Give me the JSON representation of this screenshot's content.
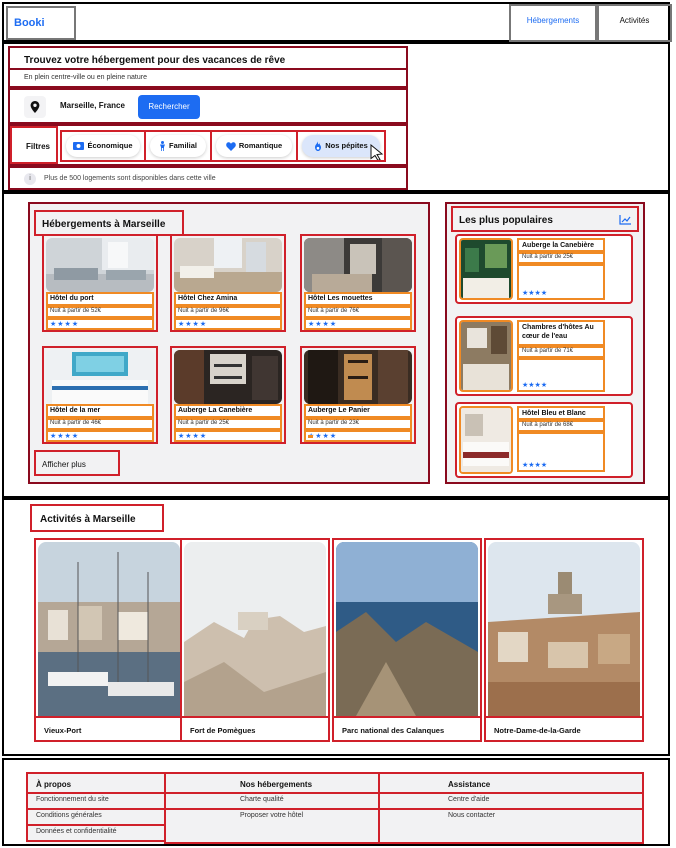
{
  "header": {
    "logo": "Booki",
    "nav": [
      "Hébergements",
      "Activités"
    ]
  },
  "search": {
    "title": "Trouvez votre hébergement pour des vacances de rêve",
    "subtitle": "En plein centre-ville ou en pleine nature",
    "location": "Marseille, France",
    "button": "Rechercher",
    "filters_label": "Filtres",
    "filters": [
      "Économique",
      "Familial",
      "Romantique",
      "Nos pépites"
    ],
    "info_icon": "i",
    "info": "Plus de 500 logements sont disponibles dans cette ville"
  },
  "hotels": {
    "title": "Hébergements à Marseille",
    "items": [
      {
        "name": "Hôtel du port",
        "price": "Nuit à partir de 52€",
        "stars": "★★★★"
      },
      {
        "name": "Hôtel Chez Amina",
        "price": "Nuit à partir de 96€",
        "stars": "★★★★"
      },
      {
        "name": "Hôtel Les mouettes",
        "price": "Nuit à partir de 76€",
        "stars": "★★★★"
      },
      {
        "name": "Hôtel de la mer",
        "price": "Nuit à partir de 46€",
        "stars": "★★★★"
      },
      {
        "name": "Auberge La Canebière",
        "price": "Nuit à partir de 25€",
        "stars": "★★★★"
      },
      {
        "name": "Auberge Le Panier",
        "price": "Nuit à partir de 23€",
        "stars": "★★★★"
      }
    ],
    "more": "Afficher plus"
  },
  "popular": {
    "title": "Les plus populaires",
    "items": [
      {
        "name": "Auberge la Canebière",
        "price": "Nuit à partir de 25€",
        "stars": "★★★★"
      },
      {
        "name": "Chambres d'hôtes Au cœur de l'eau",
        "price": "Nuit à partir de 71€",
        "stars": "★★★★"
      },
      {
        "name": "Hôtel Bleu et Blanc",
        "price": "Nuit à partir de 68€",
        "stars": "★★★★"
      }
    ]
  },
  "activities": {
    "title": "Activités à Marseille",
    "items": [
      "Vieux-Port",
      "Fort de Pomègues",
      "Parc national des Calanques",
      "Notre-Dame-de-la-Garde"
    ]
  },
  "footer": {
    "columns": [
      {
        "title": "À propos",
        "links": [
          "Fonctionnement du site",
          "Conditions générales",
          "Données et confidentialité"
        ]
      },
      {
        "title": "Nos hébergements",
        "links": [
          "Charte qualité",
          "Proposer votre hôtel"
        ]
      },
      {
        "title": "Assistance",
        "links": [
          "Centre d'aide",
          "Nous contacter"
        ]
      }
    ]
  },
  "colors": {
    "primary": "#1d6cf2",
    "light_bg": "#f2f2f3",
    "annotation_red": "#d0202a",
    "annotation_orange": "#f08a24"
  }
}
